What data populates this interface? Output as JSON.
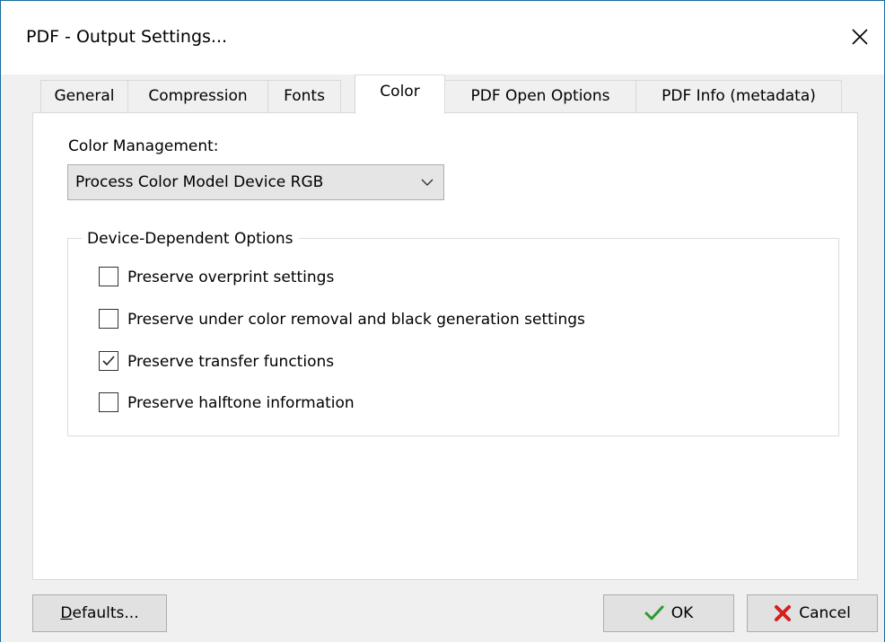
{
  "window": {
    "title": "PDF - Output Settings...",
    "close_icon": "close-icon"
  },
  "tabs": [
    {
      "label": "General",
      "active": false
    },
    {
      "label": "Compression",
      "active": false
    },
    {
      "label": "Fonts",
      "active": false
    },
    {
      "label": "Color",
      "active": true
    },
    {
      "label": "PDF Open Options",
      "active": false
    },
    {
      "label": "PDF Info (metadata)",
      "active": false
    }
  ],
  "color_tab": {
    "color_management_label": "Color Management:",
    "color_management_value": "Process Color Model Device RGB",
    "device_options": {
      "title": "Device-Dependent Options",
      "checkboxes": [
        {
          "label": "Preserve overprint settings",
          "checked": false
        },
        {
          "label": "Preserve under color removal and black generation settings",
          "checked": false
        },
        {
          "label": "Preserve transfer functions",
          "checked": true
        },
        {
          "label": "Preserve halftone information",
          "checked": false
        }
      ]
    }
  },
  "footer": {
    "defaults_label": "Defaults...",
    "ok_label": "OK",
    "cancel_label": "Cancel",
    "ok_icon": "checkmark-icon",
    "cancel_icon": "red-x-icon"
  },
  "colors": {
    "window_border": "#1b6a9c",
    "ok_icon": "#2e9b2e",
    "cancel_icon": "#d81e1e"
  }
}
